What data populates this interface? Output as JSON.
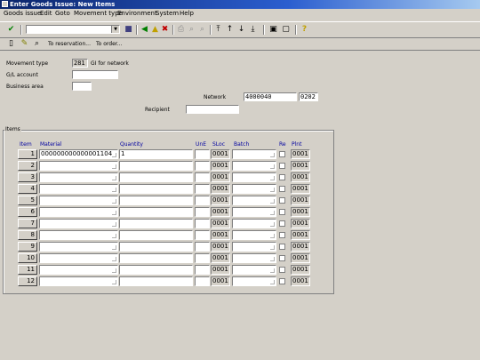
{
  "window": {
    "title": "Enter Goods Issue: New Items"
  },
  "menu": [
    "Goods issue",
    "Edit",
    "Goto",
    "Movement type",
    "Environment",
    "System",
    "Help"
  ],
  "app_toolbar": {
    "to_reservation": "To reservation...",
    "to_order": "To order..."
  },
  "header": {
    "movement_type_label": "Movement type",
    "movement_type_value": "281",
    "movement_type_desc": "GI for network",
    "gl_account_label": "G/L account",
    "gl_account_value": "",
    "business_area_label": "Business area",
    "business_area_value": "",
    "network_label": "Network",
    "network_value": "4000040",
    "network_extra": "0202",
    "recipient_label": "Recipient",
    "recipient_value": ""
  },
  "items": {
    "title": "Items",
    "columns": {
      "item": "Item",
      "material": "Material",
      "quantity": "Quantity",
      "une": "UnE",
      "sloc": "SLoc",
      "batch": "Batch",
      "re": "Re",
      "plnt": "Plnt"
    },
    "rows": [
      {
        "num": "1",
        "material": "000000000000001104",
        "quantity": "1",
        "sloc": "0001",
        "plnt": "0001"
      },
      {
        "num": "2",
        "material": "",
        "quantity": "",
        "sloc": "0001",
        "plnt": "0001"
      },
      {
        "num": "3",
        "material": "",
        "quantity": "",
        "sloc": "0001",
        "plnt": "0001"
      },
      {
        "num": "4",
        "material": "",
        "quantity": "",
        "sloc": "0001",
        "plnt": "0001"
      },
      {
        "num": "5",
        "material": "",
        "quantity": "",
        "sloc": "0001",
        "plnt": "0001"
      },
      {
        "num": "6",
        "material": "",
        "quantity": "",
        "sloc": "0001",
        "plnt": "0001"
      },
      {
        "num": "7",
        "material": "",
        "quantity": "",
        "sloc": "0001",
        "plnt": "0001"
      },
      {
        "num": "8",
        "material": "",
        "quantity": "",
        "sloc": "0001",
        "plnt": "0001"
      },
      {
        "num": "9",
        "material": "",
        "quantity": "",
        "sloc": "0001",
        "plnt": "0001"
      },
      {
        "num": "10",
        "material": "",
        "quantity": "",
        "sloc": "0001",
        "plnt": "0001"
      },
      {
        "num": "11",
        "material": "",
        "quantity": "",
        "sloc": "0001",
        "plnt": "0001"
      },
      {
        "num": "12",
        "material": "",
        "quantity": "",
        "sloc": "0001",
        "plnt": "0001"
      }
    ]
  }
}
